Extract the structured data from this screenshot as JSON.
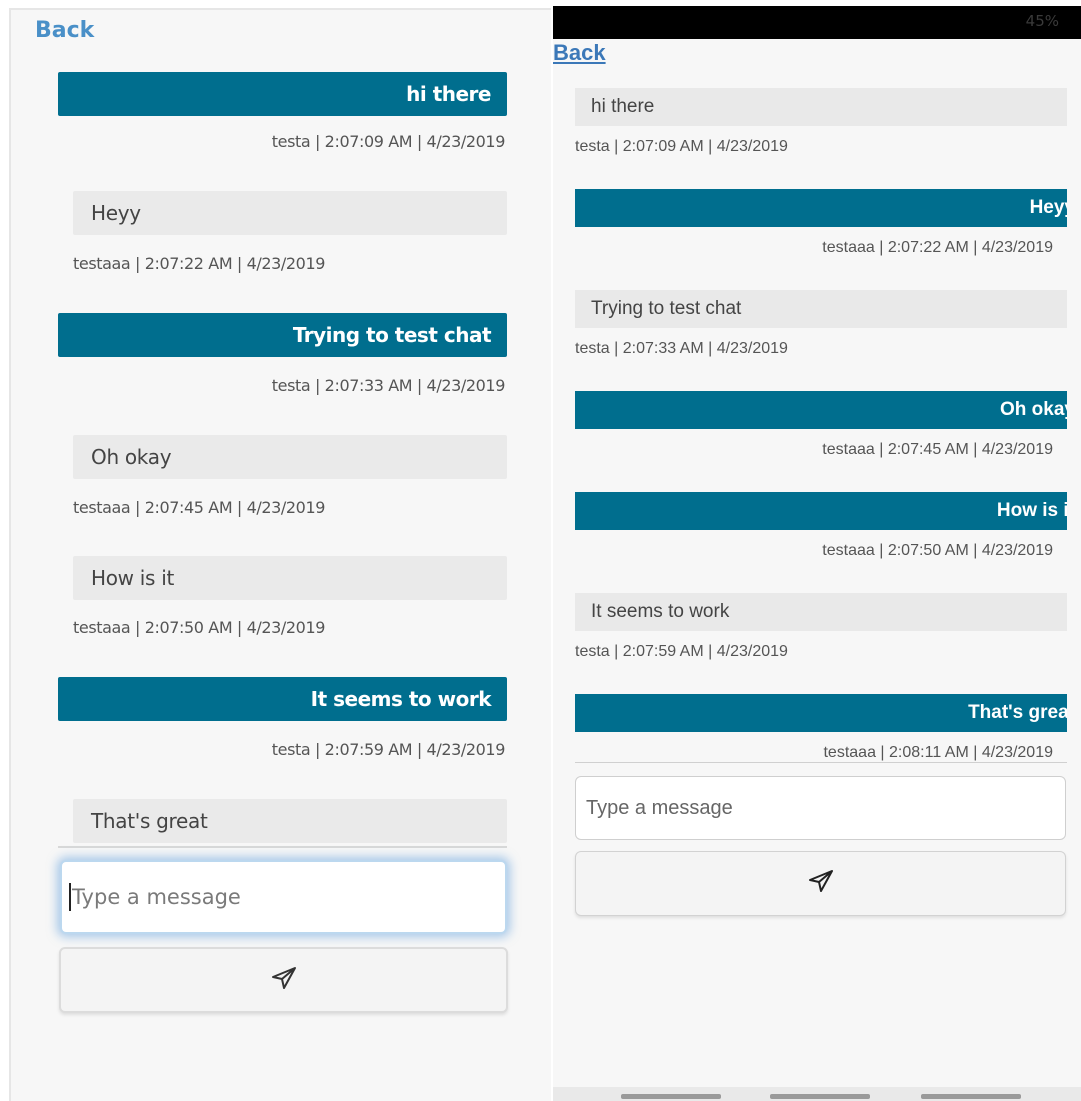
{
  "left": {
    "back_label": "Back",
    "messages": [
      {
        "side": "sent",
        "text": "hi there",
        "meta": "testa | 2:07:09 AM | 4/23/2019"
      },
      {
        "side": "recv",
        "text": "Heyy",
        "meta": "testaaa | 2:07:22 AM | 4/23/2019"
      },
      {
        "side": "sent",
        "text": "Trying to test chat",
        "meta": "testa | 2:07:33 AM | 4/23/2019"
      },
      {
        "side": "recv",
        "text": "Oh okay",
        "meta": "testaaa | 2:07:45 AM | 4/23/2019"
      },
      {
        "side": "recv",
        "text": "How is it",
        "meta": "testaaa | 2:07:50 AM | 4/23/2019"
      },
      {
        "side": "sent",
        "text": "It seems to work",
        "meta": "testa | 2:07:59 AM | 4/23/2019"
      },
      {
        "side": "recv",
        "text": "That's great",
        "meta": ""
      }
    ],
    "input_placeholder": "Type a message",
    "send_icon": "paper-plane-icon"
  },
  "right": {
    "status_text": "45%",
    "back_label": "Back",
    "messages": [
      {
        "side": "recv",
        "text": "hi there",
        "meta": "testa | 2:07:09 AM | 4/23/2019"
      },
      {
        "side": "sent",
        "text": "Heyy",
        "meta": "testaaa | 2:07:22 AM | 4/23/2019"
      },
      {
        "side": "recv",
        "text": "Trying to test chat",
        "meta": "testa | 2:07:33 AM | 4/23/2019"
      },
      {
        "side": "sent",
        "text": "Oh okay",
        "meta": "testaaa | 2:07:45 AM | 4/23/2019"
      },
      {
        "side": "sent",
        "text": "How is it",
        "meta": "testaaa | 2:07:50 AM | 4/23/2019"
      },
      {
        "side": "recv",
        "text": "It seems to work",
        "meta": "testa | 2:07:59 AM | 4/23/2019"
      },
      {
        "side": "sent",
        "text": "That's great",
        "meta": "testaaa | 2:08:11 AM | 4/23/2019"
      }
    ],
    "input_placeholder": "Type a message",
    "send_icon": "paper-plane-icon"
  },
  "colors": {
    "sent_bubble": "#006e8e",
    "recv_bubble": "#eaeaea",
    "back_link": "#4a90c8",
    "input_focus_glow": "#64a0dc"
  }
}
